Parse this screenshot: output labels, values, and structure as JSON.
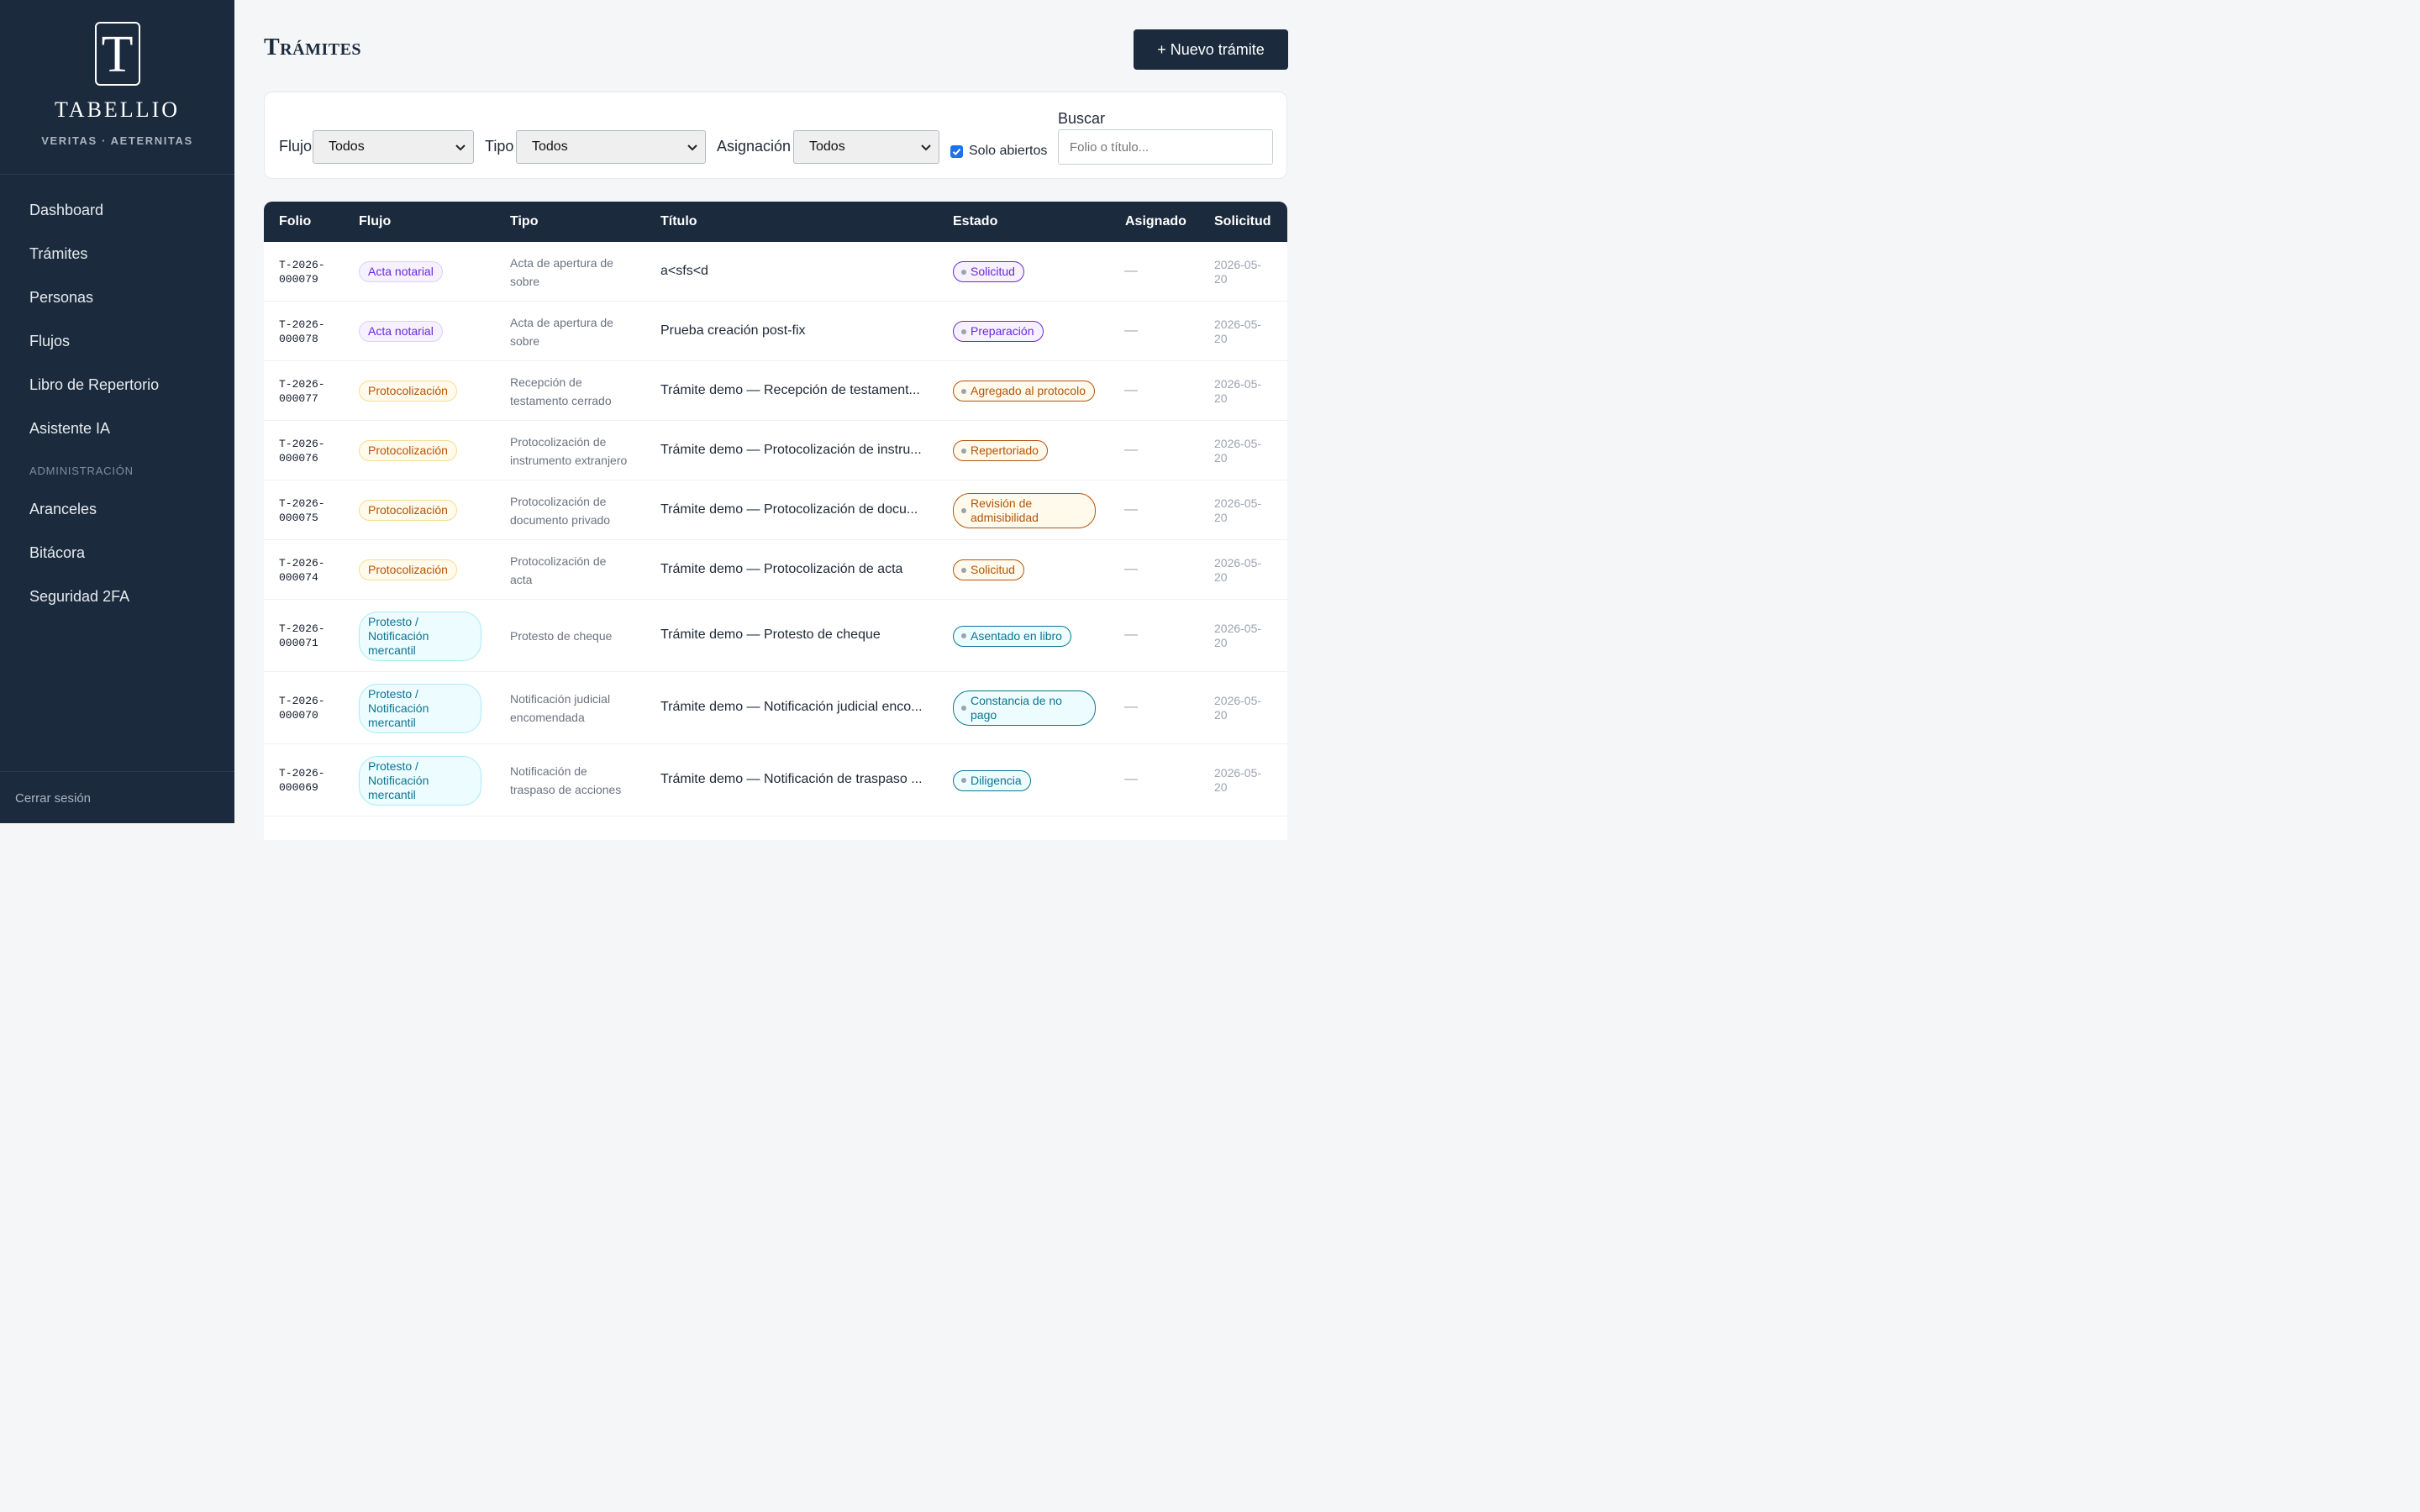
{
  "sidebar": {
    "logo_letter": "T",
    "brand_name": "TABELLIO",
    "brand_tagline": "VERITAS · AETERNITAS",
    "items": [
      {
        "label": "Dashboard"
      },
      {
        "label": "Trámites"
      },
      {
        "label": "Personas"
      },
      {
        "label": "Flujos"
      },
      {
        "label": "Libro de Repertorio"
      },
      {
        "label": "Asistente IA"
      }
    ],
    "section_admin": "ADMINISTRACIÓN",
    "admin_items": [
      {
        "label": "Aranceles"
      },
      {
        "label": "Bitácora"
      },
      {
        "label": "Seguridad 2FA"
      }
    ],
    "logout_label": "Cerrar sesión"
  },
  "header": {
    "title": "Trámites",
    "new_button": "+ Nuevo trámite"
  },
  "filters": {
    "flujo_label": "Flujo",
    "flujo_value": "Todos",
    "tipo_label": "Tipo",
    "tipo_value": "Todos",
    "asignacion_label": "Asignación",
    "asignacion_value": "Todos",
    "solo_abiertos_label": "Solo abiertos",
    "solo_abiertos_checked": true,
    "buscar_label": "Buscar",
    "buscar_placeholder": "Folio o título..."
  },
  "table": {
    "columns": [
      "Folio",
      "Flujo",
      "Tipo",
      "Título",
      "Estado",
      "Asignado",
      "Solicitud"
    ],
    "rows": [
      {
        "folio": [
          "T-2026-",
          "000079"
        ],
        "flujo": [
          "Acta notarial"
        ],
        "flujo_kind": "acta",
        "tipo": [
          "Acta de apertura de",
          "sobre"
        ],
        "titulo": "a<sfs<d",
        "estado": [
          "Solicitud"
        ],
        "asignado": "—",
        "solicitud": [
          "2026-05-",
          "20"
        ]
      },
      {
        "folio": [
          "T-2026-",
          "000078"
        ],
        "flujo": [
          "Acta notarial"
        ],
        "flujo_kind": "acta",
        "tipo": [
          "Acta de apertura de",
          "sobre"
        ],
        "titulo": "Prueba creación post-fix",
        "estado": [
          "Preparación"
        ],
        "asignado": "—",
        "solicitud": [
          "2026-05-",
          "20"
        ]
      },
      {
        "folio": [
          "T-2026-",
          "000077"
        ],
        "flujo": [
          "Protocolización"
        ],
        "flujo_kind": "proto",
        "tipo": [
          "Recepción de",
          "testamento cerrado"
        ],
        "titulo": "Trámite demo — Recepción de testament...",
        "estado": [
          "Agregado al protocolo"
        ],
        "asignado": "—",
        "solicitud": [
          "2026-05-",
          "20"
        ]
      },
      {
        "folio": [
          "T-2026-",
          "000076"
        ],
        "flujo": [
          "Protocolización"
        ],
        "flujo_kind": "proto",
        "tipo": [
          "Protocolización de",
          "instrumento extranjero"
        ],
        "titulo": "Trámite demo — Protocolización de instru...",
        "estado": [
          "Repertoriado"
        ],
        "asignado": "—",
        "solicitud": [
          "2026-05-",
          "20"
        ]
      },
      {
        "folio": [
          "T-2026-",
          "000075"
        ],
        "flujo": [
          "Protocolización"
        ],
        "flujo_kind": "proto",
        "tipo": [
          "Protocolización de",
          "documento privado"
        ],
        "titulo": "Trámite demo — Protocolización de docu...",
        "estado": [
          "Revisión de",
          "admisibilidad"
        ],
        "asignado": "—",
        "solicitud": [
          "2026-05-",
          "20"
        ]
      },
      {
        "folio": [
          "T-2026-",
          "000074"
        ],
        "flujo": [
          "Protocolización"
        ],
        "flujo_kind": "proto",
        "tipo": [
          "Protocolización de",
          "acta"
        ],
        "titulo": "Trámite demo — Protocolización de acta",
        "estado": [
          "Solicitud"
        ],
        "asignado": "—",
        "solicitud": [
          "2026-05-",
          "20"
        ]
      },
      {
        "folio": [
          "T-2026-",
          "000071"
        ],
        "flujo": [
          "Protesto /",
          "Notificación",
          "mercantil"
        ],
        "flujo_kind": "prot",
        "tipo": [
          "Protesto de cheque"
        ],
        "titulo": "Trámite demo — Protesto de cheque",
        "estado": [
          "Asentado en libro"
        ],
        "asignado": "—",
        "solicitud": [
          "2026-05-",
          "20"
        ]
      },
      {
        "folio": [
          "T-2026-",
          "000070"
        ],
        "flujo": [
          "Protesto /",
          "Notificación",
          "mercantil"
        ],
        "flujo_kind": "prot",
        "tipo": [
          "Notificación judicial",
          "encomendada"
        ],
        "titulo": "Trámite demo — Notificación judicial enco...",
        "estado": [
          "Constancia de no",
          "pago"
        ],
        "asignado": "—",
        "solicitud": [
          "2026-05-",
          "20"
        ]
      },
      {
        "folio": [
          "T-2026-",
          "000069"
        ],
        "flujo": [
          "Protesto /",
          "Notificación",
          "mercantil"
        ],
        "flujo_kind": "prot",
        "tipo": [
          "Notificación de",
          "traspaso de acciones"
        ],
        "titulo": "Trámite demo — Notificación de traspaso ...",
        "estado": [
          "Diligencia"
        ],
        "asignado": "—",
        "solicitud": [
          "2026-05-",
          "20"
        ]
      }
    ]
  }
}
